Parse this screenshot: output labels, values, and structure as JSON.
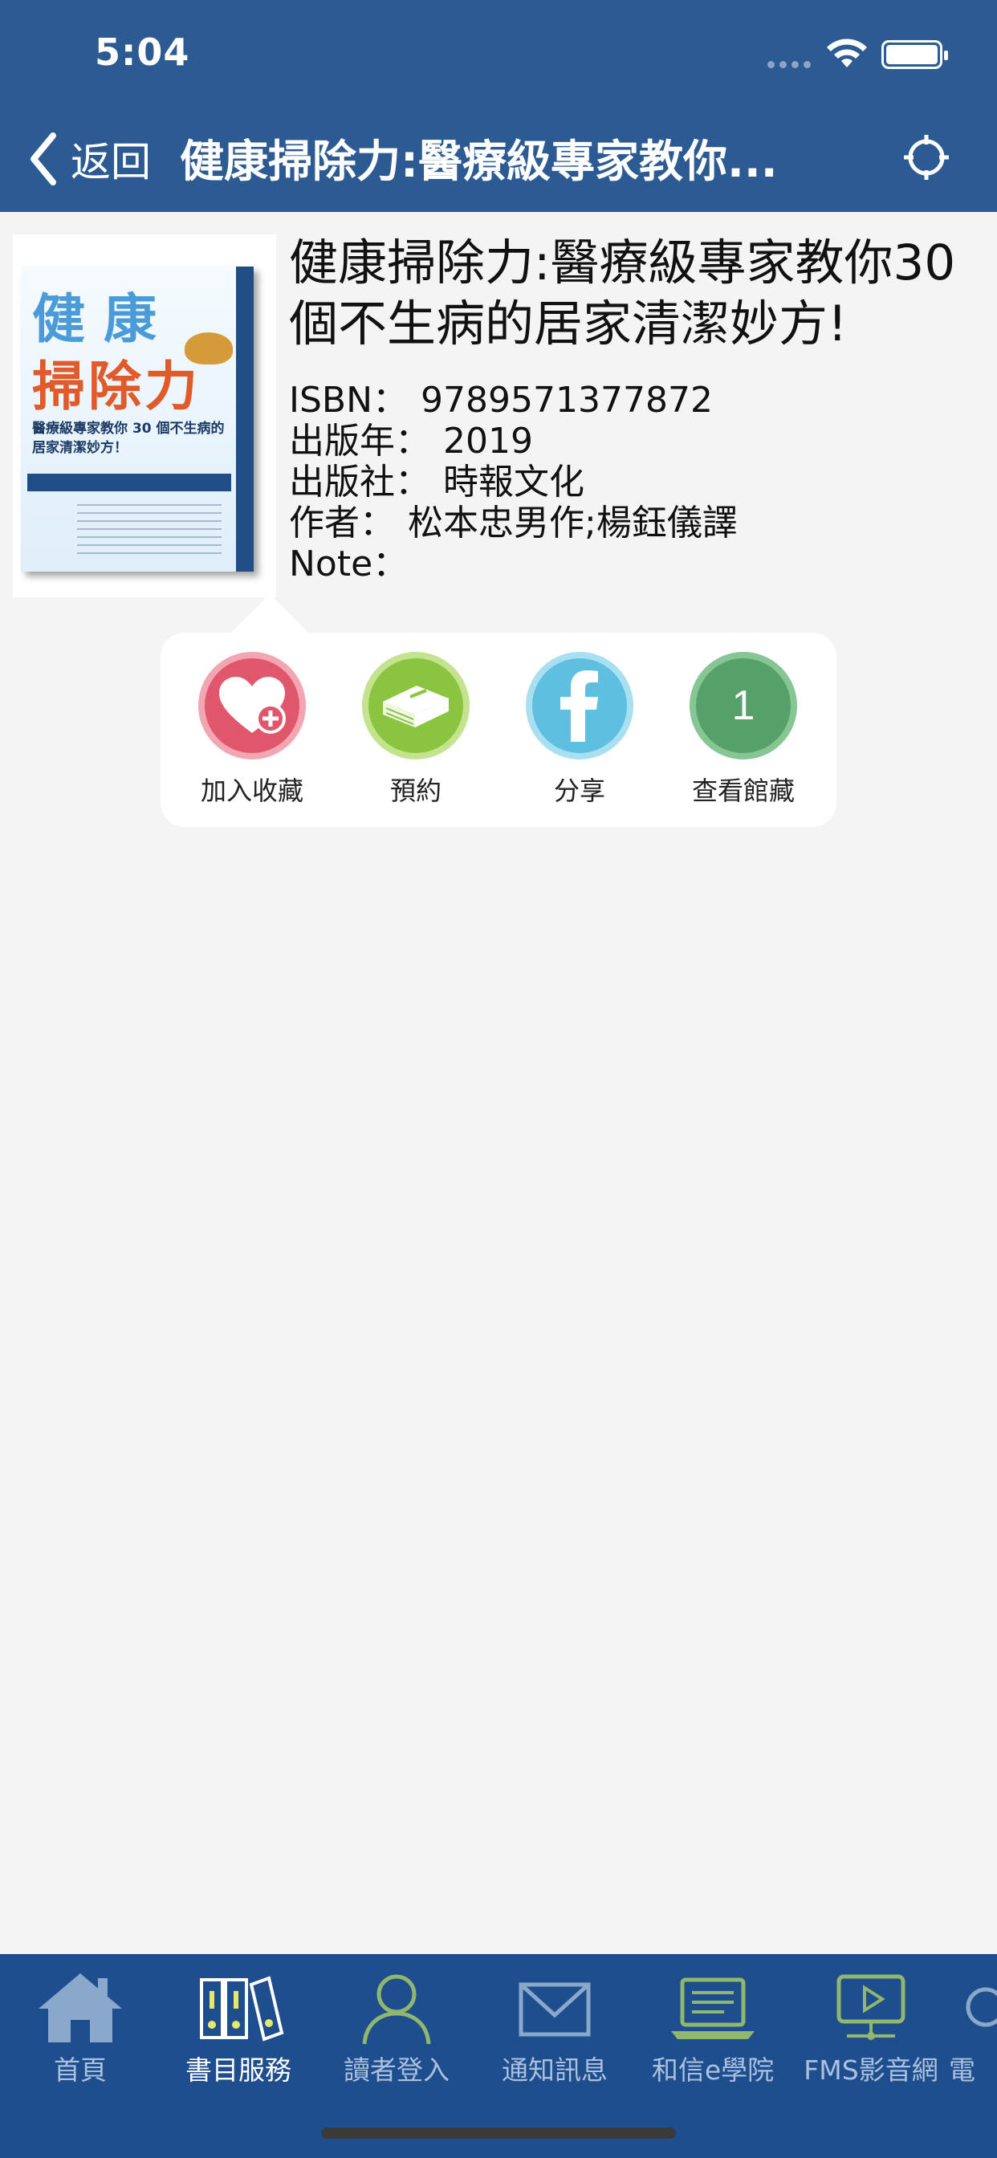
{
  "status_bar": {
    "time": "5:04"
  },
  "nav": {
    "back_label": "返回",
    "title": "健康掃除力:醫療級專家教你..."
  },
  "book": {
    "title": "健康掃除力:醫療級專家教你30個不生病的居家清潔妙方!",
    "isbn_label": "ISBN：",
    "isbn": "9789571377872",
    "year_label": "出版年：",
    "year": "2019",
    "publisher_label": "出版社：",
    "publisher": "時報文化",
    "author_label": "作者：",
    "author": "松本忠男作;楊鈺儀譯",
    "note_label": "Note："
  },
  "cover": {
    "line1": "健 康",
    "line2": "掃除力",
    "sub": "醫療級專家教你 30 個不生病的居家清潔妙方！"
  },
  "actions": [
    {
      "label": "加入收藏",
      "icon": "heart-plus-icon",
      "color": "#e0566a"
    },
    {
      "label": "預約",
      "icon": "book-icon",
      "color": "#8bc53f"
    },
    {
      "label": "分享",
      "icon": "facebook-icon",
      "color": "#5fbfe0"
    },
    {
      "label": "查看館藏",
      "icon": "holdings-count-icon",
      "color": "#56a06a",
      "count": "1"
    }
  ],
  "tabbar": {
    "items": [
      {
        "label": "首頁",
        "icon": "home-icon"
      },
      {
        "label": "書目服務",
        "icon": "books-icon",
        "active": true
      },
      {
        "label": "讀者登入",
        "icon": "user-icon"
      },
      {
        "label": "通知訊息",
        "icon": "mail-icon"
      },
      {
        "label": "和信e學院",
        "icon": "laptop-icon"
      },
      {
        "label": "FMS影音網",
        "icon": "video-icon"
      },
      {
        "label": "電"
      }
    ]
  },
  "colors": {
    "header": "#2c5a93",
    "tabbar": "#1f4e8e",
    "background": "#f4f4f4"
  }
}
